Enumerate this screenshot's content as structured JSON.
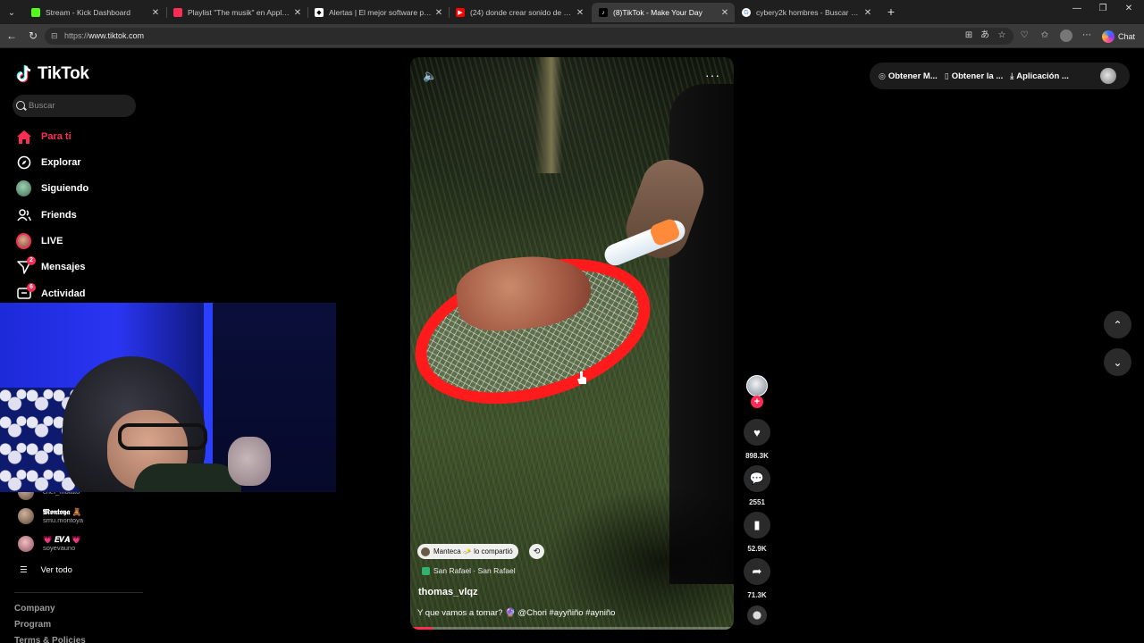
{
  "browser": {
    "tabs": [
      {
        "title": "Stream - Kick Dashboard",
        "favicon_color": "#53fc18",
        "active": false
      },
      {
        "title": "Playlist \"The musik\" en Apple Music",
        "favicon_color": "#fa2d55",
        "active": false
      },
      {
        "title": "Alertas | El mejor software para podcasts",
        "favicon_color": "#ffffff",
        "active": false
      },
      {
        "title": "(24) donde crear sonido de alertas",
        "favicon_color": "#ff0000",
        "active": false
      },
      {
        "title": "(8)TikTok - Make Your Day",
        "favicon_color": "#000000",
        "active": true
      },
      {
        "title": "cybery2k hombres - Buscar con Google",
        "favicon_color": "#4285f4",
        "active": false
      }
    ],
    "url_protocol": "https://",
    "url_host": "www.tiktok.com",
    "chat_label": "Chat"
  },
  "tiktok": {
    "logo_text": "TikTok",
    "search_placeholder": "Buscar",
    "nav": [
      {
        "label": "Para ti",
        "icon": "home-icon",
        "active": true
      },
      {
        "label": "Explorar",
        "icon": "compass-icon",
        "active": false
      },
      {
        "label": "Siguiendo",
        "icon": "following-avatar-icon",
        "active": false
      },
      {
        "label": "Friends",
        "icon": "friends-icon",
        "active": false
      },
      {
        "label": "LIVE",
        "icon": "live-icon",
        "active": false
      },
      {
        "label": "Mensajes",
        "icon": "messages-icon",
        "active": false,
        "badge": "2"
      },
      {
        "label": "Actividad",
        "icon": "activity-icon",
        "active": false,
        "badge": "6"
      }
    ],
    "following_accounts": [
      {
        "name": "",
        "handle": "chef_motato"
      },
      {
        "name": "𝕸𝖔𝖓𝖙𝖔𝖞𝖆 🧸",
        "handle": "smu.montoya"
      },
      {
        "name": "💗 𝑬𝑽𝑨 💗",
        "handle": "soyevauno"
      }
    ],
    "see_all_label": "Ver todo",
    "footer_links": [
      "Company",
      "Program",
      "Terms & Policies"
    ]
  },
  "video": {
    "repost_chip": "Manteca 🧈 lo compartió",
    "location": "San Rafael · San Rafael",
    "author": "thomas_vlqz",
    "caption": "Y que vamos a tomar? 🔮 @Chori #ayyñiño #ayniño",
    "progress": 0.07,
    "likes": "898.3K",
    "comments": "2551",
    "saves": "52.9K",
    "shares": "71.3K"
  },
  "top_right": {
    "coins_label": "Obtener M...",
    "app_label": "Obtener la ...",
    "download_label": "Aplicación ..."
  },
  "colors": {
    "accent": "#fe2c55",
    "background": "#000000"
  }
}
